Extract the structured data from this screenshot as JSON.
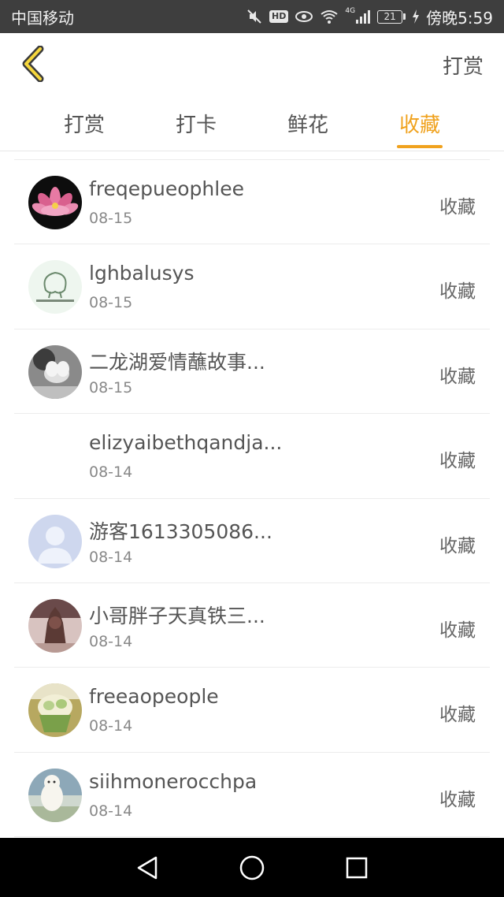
{
  "status_bar": {
    "carrier": "中国移动",
    "network": "4G",
    "battery": "21",
    "time": "傍晚5:59",
    "hd": "HD"
  },
  "header": {
    "title": "打赏",
    "back_icon": "chevron-left-icon",
    "accent_color": "#f0a21e"
  },
  "tabs": [
    {
      "label": "打赏",
      "active": false
    },
    {
      "label": "打卡",
      "active": false
    },
    {
      "label": "鲜花",
      "active": false
    },
    {
      "label": "收藏",
      "active": true
    }
  ],
  "list": [
    {
      "name": "freqepueophlee",
      "date": "08-15",
      "action": "收藏",
      "avatar": "lotus-flower"
    },
    {
      "name": "lghbalusys",
      "date": "08-15",
      "action": "收藏",
      "avatar": "cartoon-sketch"
    },
    {
      "name": "二龙湖爱情蘸故事...",
      "date": "08-15",
      "action": "收藏",
      "avatar": "grayscale-flower"
    },
    {
      "name": "elizyaibethqandja...",
      "date": "08-14",
      "action": "收藏",
      "avatar": "none"
    },
    {
      "name": "游客1613305086...",
      "date": "08-14",
      "action": "收藏",
      "avatar": "default-user"
    },
    {
      "name": "小哥胖子天真铁三...",
      "date": "08-14",
      "action": "收藏",
      "avatar": "dark-figure"
    },
    {
      "name": "freeaopeople",
      "date": "08-14",
      "action": "收藏",
      "avatar": "cupcake"
    },
    {
      "name": "siihmonerocchpa",
      "date": "08-14",
      "action": "收藏",
      "avatar": "polar-bear"
    }
  ],
  "nav_bar": {
    "back": "triangle-back-icon",
    "home": "circle-home-icon",
    "recent": "square-recent-icon"
  }
}
